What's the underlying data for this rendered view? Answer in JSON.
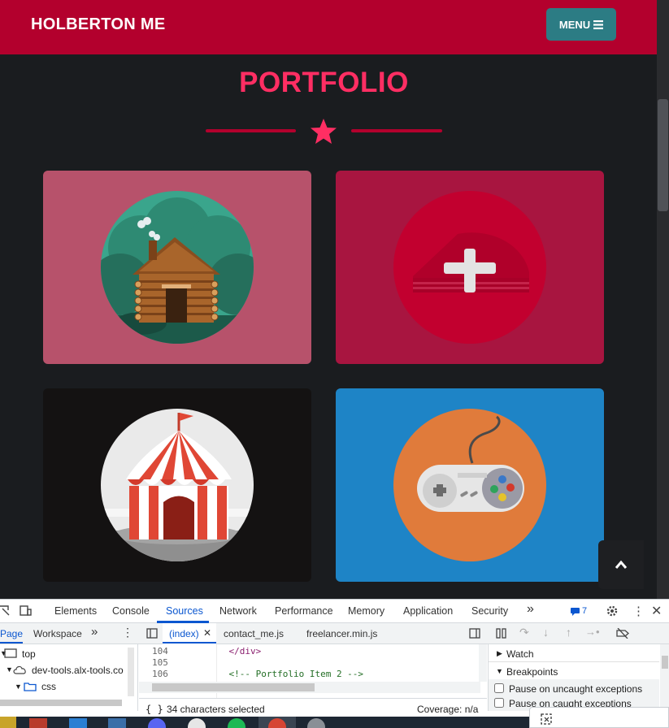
{
  "navbar": {
    "brand": "HOLBERTON ME",
    "menu_label": "MENU",
    "menu_icon": "bars-icon"
  },
  "section": {
    "title": "PORTFOLIO"
  },
  "portfolio": {
    "items": [
      {
        "name": "cabin",
        "bg": "#b7526b"
      },
      {
        "name": "cake",
        "bg": "#a81540"
      },
      {
        "name": "circus",
        "bg": "#141212"
      },
      {
        "name": "game",
        "bg": "#1e84c6"
      }
    ]
  },
  "colors": {
    "accent": "#ff2e63",
    "brand": "#b3002d",
    "menu": "#2c7c84"
  },
  "devtools": {
    "tabs": [
      "Elements",
      "Console",
      "Sources",
      "Network",
      "Performance",
      "Memory",
      "Application",
      "Security"
    ],
    "active_tab": "Sources",
    "issues_count": "7",
    "nav_tabs": [
      "Page",
      "Workspace"
    ],
    "file_tabs": [
      "(index)",
      "contact_me.js",
      "freelancer.min.js"
    ],
    "tree": [
      "top",
      "dev-tools.alx-tools.co",
      "css"
    ],
    "code_lines": [
      {
        "num": "104",
        "text": "    </div>"
      },
      {
        "num": "105",
        "text": ""
      },
      {
        "num": "106",
        "text": "    <!-- Portfolio Item 2 -->"
      }
    ],
    "selection": "34 characters selected",
    "coverage": "Coverage: n/a",
    "right_sections": [
      "Watch",
      "Breakpoints"
    ],
    "checkboxes": [
      "Pause on uncaught exceptions",
      "Pause on caught exceptions"
    ]
  }
}
